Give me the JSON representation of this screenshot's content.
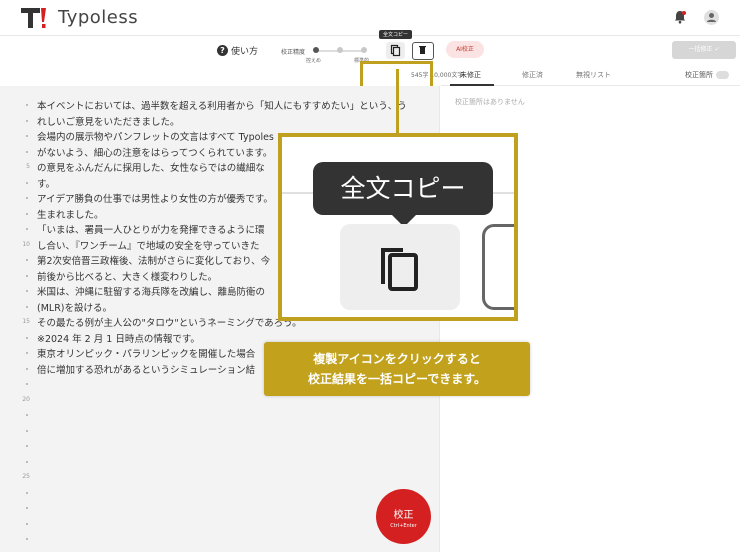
{
  "header": {
    "logo_mark": "T!",
    "logo_text": "Typoless"
  },
  "toolbar": {
    "help_label": "使い方",
    "accuracy_label": "校正精度",
    "accuracy_ticks": [
      "控えめ",
      "標準的"
    ],
    "copy_tooltip": "全文コピー",
    "char_count": "545字 10,000文字",
    "ai_label": "AI校正",
    "bulk_fix_label": "一括修正"
  },
  "sidebar": {
    "tabs": [
      "未修正",
      "修正済",
      "無視リスト"
    ],
    "fix_location_label": "校正箇所",
    "empty_message": "校正箇所はありません"
  },
  "editor": {
    "lines": [
      {
        "n": "",
        "text": "本イベントにおいては、過半数を超える利用者から「知人にもすすめたい」という、う"
      },
      {
        "n": "",
        "text": "れしいご意見をいただきました。"
      },
      {
        "n": "",
        "text": "会場内の展示物やパンフレットの文言はすべて Typoles"
      },
      {
        "n": "",
        "text": "がないよう、細心の注意をはらってつくられています。"
      },
      {
        "n": "5",
        "text": "の意見をふんだんに採用した、女性ならではの繊細な"
      },
      {
        "n": "",
        "text": "す。"
      },
      {
        "n": "",
        "text": "アイデア勝負の仕事では男性より女性の方が優秀です。"
      },
      {
        "n": "",
        "text": "生まれました。"
      },
      {
        "n": "",
        "text": "「いまは、署員一人ひとりが力を発揮できるように環"
      },
      {
        "n": "10",
        "text": "し合い、『ワンチーム』で地域の安全を守っていきた"
      },
      {
        "n": "",
        "text": "第2次安倍晋三政権後、法制がさらに変化しており、今"
      },
      {
        "n": "",
        "text": "前後から比べると、大きく様変わりした。"
      },
      {
        "n": "",
        "text": "米国は、沖縄に駐留する海兵隊を改編し、離島防衛の"
      },
      {
        "n": "",
        "text": "(MLR)を設ける。"
      },
      {
        "n": "15",
        "text": "その最たる例が主人公の\"タロウ\"というネーミングであろう。"
      },
      {
        "n": "",
        "text": "※2024 年 2 月 1 日時点の情報です。"
      },
      {
        "n": "",
        "text": "東京オリンピック・パラリンピックを開催した場合"
      },
      {
        "n": "",
        "text": "倍に増加する恐れがあるというシミュレーション結"
      },
      {
        "n": "",
        "text": ""
      },
      {
        "n": "20",
        "text": ""
      },
      {
        "n": "",
        "text": ""
      },
      {
        "n": "",
        "text": ""
      },
      {
        "n": "",
        "text": ""
      },
      {
        "n": "",
        "text": ""
      },
      {
        "n": "25",
        "text": ""
      },
      {
        "n": "",
        "text": ""
      },
      {
        "n": "",
        "text": ""
      },
      {
        "n": "",
        "text": ""
      },
      {
        "n": "",
        "text": ""
      }
    ],
    "proofread_button": "校正",
    "proofread_shortcut": "Ctrl+Enter"
  },
  "callout": {
    "zoom_tooltip": "全文コピー",
    "caption_line1": "複製アイコンをクリックすると",
    "caption_line2": "校正結果を一括コピーできます。"
  },
  "colors": {
    "accent": "#c2a11c",
    "brand_red": "#d42020"
  }
}
